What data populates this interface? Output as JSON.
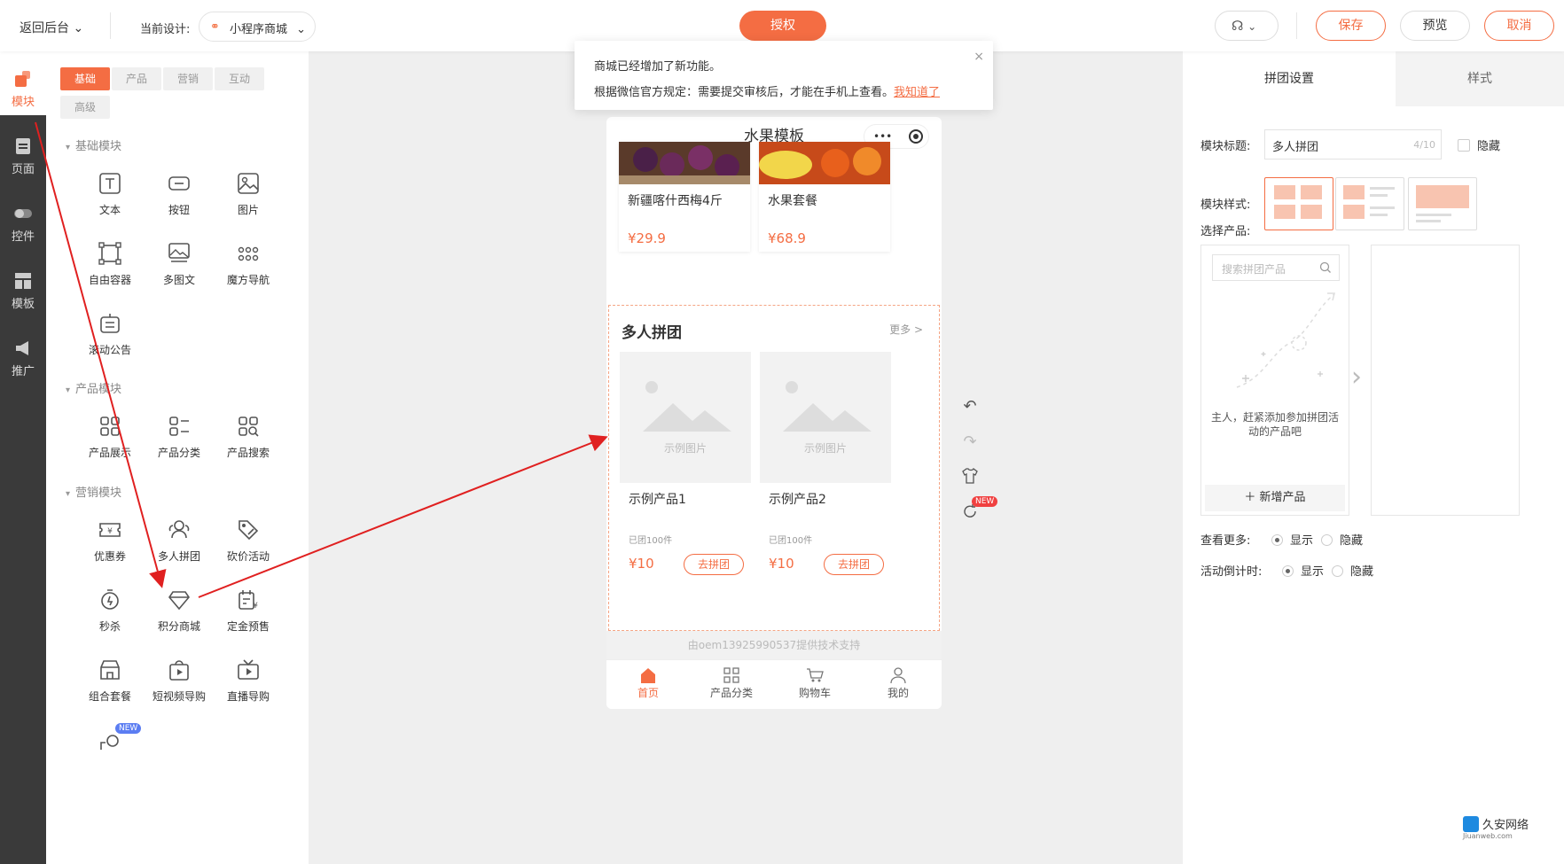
{
  "topbar": {
    "back_label": "返回后台",
    "design_label": "当前设计:",
    "design_value": "小程序商城",
    "auth_label": "授权",
    "save_label": "保存",
    "preview_label": "预览",
    "cancel_label": "取消"
  },
  "sidebar": {
    "items": [
      {
        "label": "模块",
        "icon": "blocks-icon"
      },
      {
        "label": "页面",
        "icon": "page-icon"
      },
      {
        "label": "控件",
        "icon": "toggle-icon"
      },
      {
        "label": "模板",
        "icon": "template-icon"
      },
      {
        "label": "推广",
        "icon": "megaphone-icon"
      }
    ]
  },
  "panel": {
    "tabs": [
      "基础",
      "产品",
      "营销",
      "互动",
      "高级"
    ],
    "sections": {
      "basic": "基础模块",
      "product": "产品模块",
      "marketing": "营销模块"
    },
    "basic_modules": [
      "文本",
      "按钮",
      "图片",
      "自由容器",
      "多图文",
      "魔方导航",
      "滚动公告"
    ],
    "product_modules": [
      "产品展示",
      "产品分类",
      "产品搜索"
    ],
    "marketing_modules": [
      "优惠券",
      "多人拼团",
      "砍价活动",
      "秒杀",
      "积分商城",
      "定金预售",
      "组合套餐",
      "短视频导购",
      "直播导购"
    ],
    "new_badge": "NEW"
  },
  "notice": {
    "line1": "商城已经增加了新功能。",
    "line2": "根据微信官方规定：需要提交审核后，才能在手机上查看。",
    "link": "我知道了",
    "close": "×"
  },
  "phone": {
    "title": "水果模板",
    "capsule_dots": "•••",
    "products_top": [
      {
        "name": "新疆喀什西梅4斤",
        "price": "¥29.9"
      },
      {
        "name": "水果套餐",
        "price": "¥68.9"
      }
    ],
    "group": {
      "title": "多人拼团",
      "more": "更多 >",
      "placeholder": "示例图片",
      "items": [
        {
          "name": "示例产品1",
          "sold": "已团100件",
          "price": "¥10",
          "button": "去拼团"
        },
        {
          "name": "示例产品2",
          "sold": "已团100件",
          "price": "¥10",
          "button": "去拼团"
        }
      ]
    },
    "support": "由oem13925990537提供技术支持",
    "tabbar": [
      "首页",
      "产品分类",
      "购物车",
      "我的"
    ]
  },
  "tools": {
    "new_badge": "NEW"
  },
  "rpanel": {
    "tab_settings": "拼团设置",
    "tab_style": "样式",
    "title_label": "模块标题:",
    "title_value": "多人拼团",
    "title_count": "4/10",
    "hide_label": "隐藏",
    "style_label": "模块样式:",
    "select_label": "选择产品:",
    "search_placeholder": "搜索拼团产品",
    "empty_text": "主人，赶紧添加参加拼团活动的产品吧",
    "add_label": "＋ 新增产品",
    "more_label": "查看更多:",
    "countdown_label": "活动倒计时:",
    "show": "显示",
    "hide": "隐藏"
  },
  "watermark": {
    "title": "久安网络",
    "sub": "Jiuanweb.com"
  },
  "colors": {
    "accent": "#f46d43",
    "sidebar": "#3a3a3a",
    "arrow": "#e02020"
  }
}
